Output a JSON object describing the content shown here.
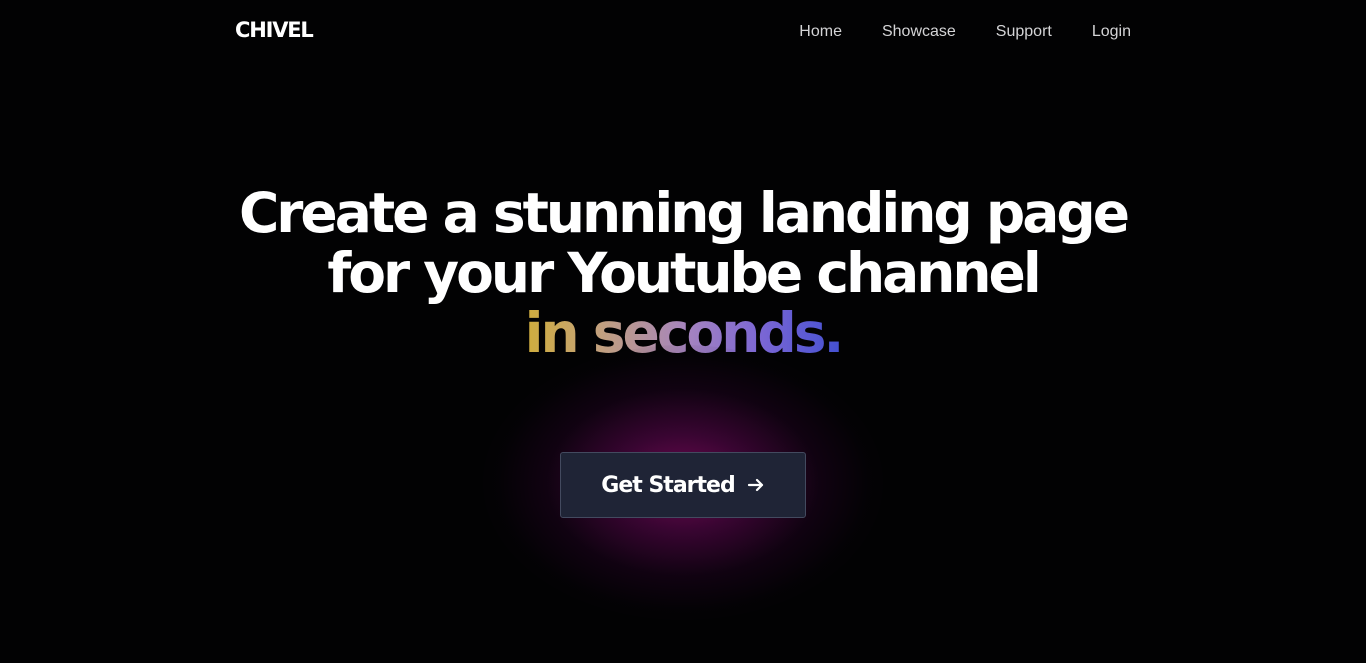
{
  "header": {
    "logo": "CHIVEL",
    "nav": [
      {
        "label": "Home"
      },
      {
        "label": "Showcase"
      },
      {
        "label": "Support"
      },
      {
        "label": "Login"
      }
    ]
  },
  "hero": {
    "line1": "Create a stunning landing page",
    "line2": "for your Youtube channel",
    "line3": "in seconds.",
    "cta_label": "Get Started",
    "cta_icon": "arrow-right-icon"
  },
  "colors": {
    "background": "#020203",
    "button": "#1f2436",
    "gradient": [
      "#d0ad3c",
      "#c4a27a",
      "#a483c0",
      "#7a66d4",
      "#4451d2"
    ],
    "glow": "#960a6e"
  }
}
